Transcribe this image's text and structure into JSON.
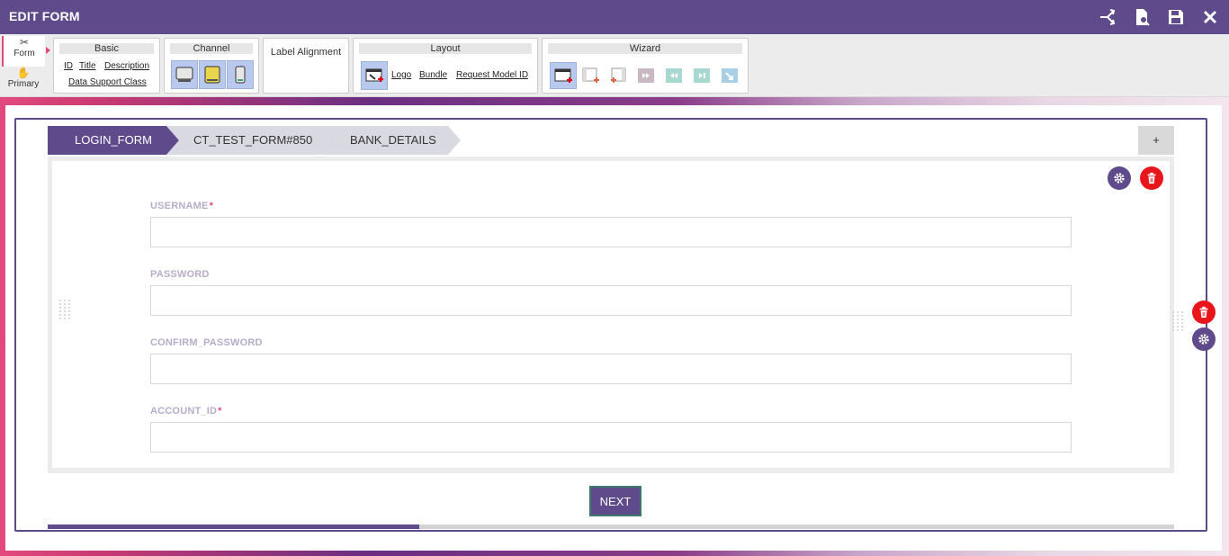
{
  "app": {
    "title": "EDIT FORM"
  },
  "side_tabs": [
    {
      "label": "Form"
    },
    {
      "label": "Primary"
    }
  ],
  "ribbon": {
    "basic": {
      "header": "Basic",
      "links": [
        "ID",
        "Title",
        "Description",
        "Data Support Class"
      ]
    },
    "channel": {
      "header": "Channel"
    },
    "label_alignment": {
      "header": "Label Alignment"
    },
    "layout": {
      "header": "Layout",
      "links": [
        "Logo",
        "Bundle",
        "Request Model ID"
      ]
    },
    "wizard": {
      "header": "Wizard"
    }
  },
  "steps": [
    {
      "label": "LOGIN_FORM",
      "active": true
    },
    {
      "label": "CT_TEST_FORM#850",
      "active": false
    },
    {
      "label": "BANK_DETAILS",
      "active": false
    }
  ],
  "add_step_label": "+",
  "fields": [
    {
      "label": "USERNAME",
      "required": "*",
      "value": ""
    },
    {
      "label": "PASSWORD",
      "required": "",
      "value": ""
    },
    {
      "label": "CONFIRM_PASSWORD",
      "required": "",
      "value": ""
    },
    {
      "label": "ACCOUNT_ID",
      "required": "*",
      "value": ""
    }
  ],
  "next_label": "NEXT",
  "progress": 0.33,
  "colors": {
    "accent": "#5f4a8b",
    "danger": "#e8151b",
    "required": "#e04b7a",
    "channel_bg": "#b9c9ee"
  }
}
